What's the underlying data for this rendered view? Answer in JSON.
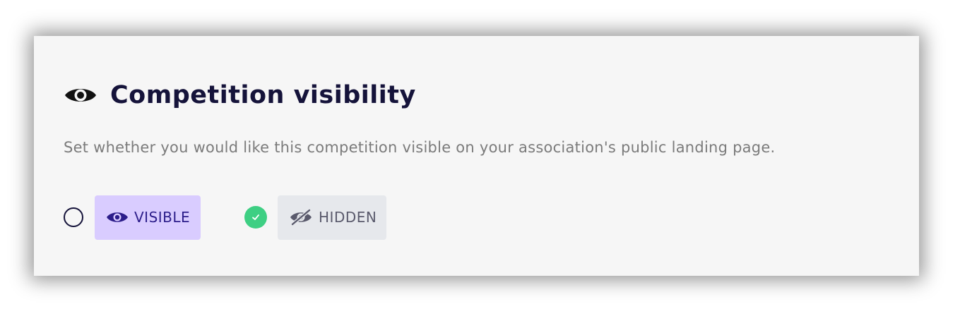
{
  "section": {
    "title": "Competition visibility",
    "title_icon": "eye-icon",
    "description": "Set whether you would like this competition visible on your association's public landing page."
  },
  "options": [
    {
      "label": "VISIBLE",
      "icon": "eye-icon",
      "selected": false,
      "bg_color": "#d9ccff",
      "text_color": "#2c1d8a"
    },
    {
      "label": "HIDDEN",
      "icon": "eye-slash-icon",
      "selected": true,
      "bg_color": "#e6e8ec",
      "text_color": "#5a5a6c"
    }
  ],
  "colors": {
    "card_bg": "#f6f6f6",
    "title": "#15133a",
    "description": "#7b7b7b",
    "selected_check": "#3ecf83"
  }
}
